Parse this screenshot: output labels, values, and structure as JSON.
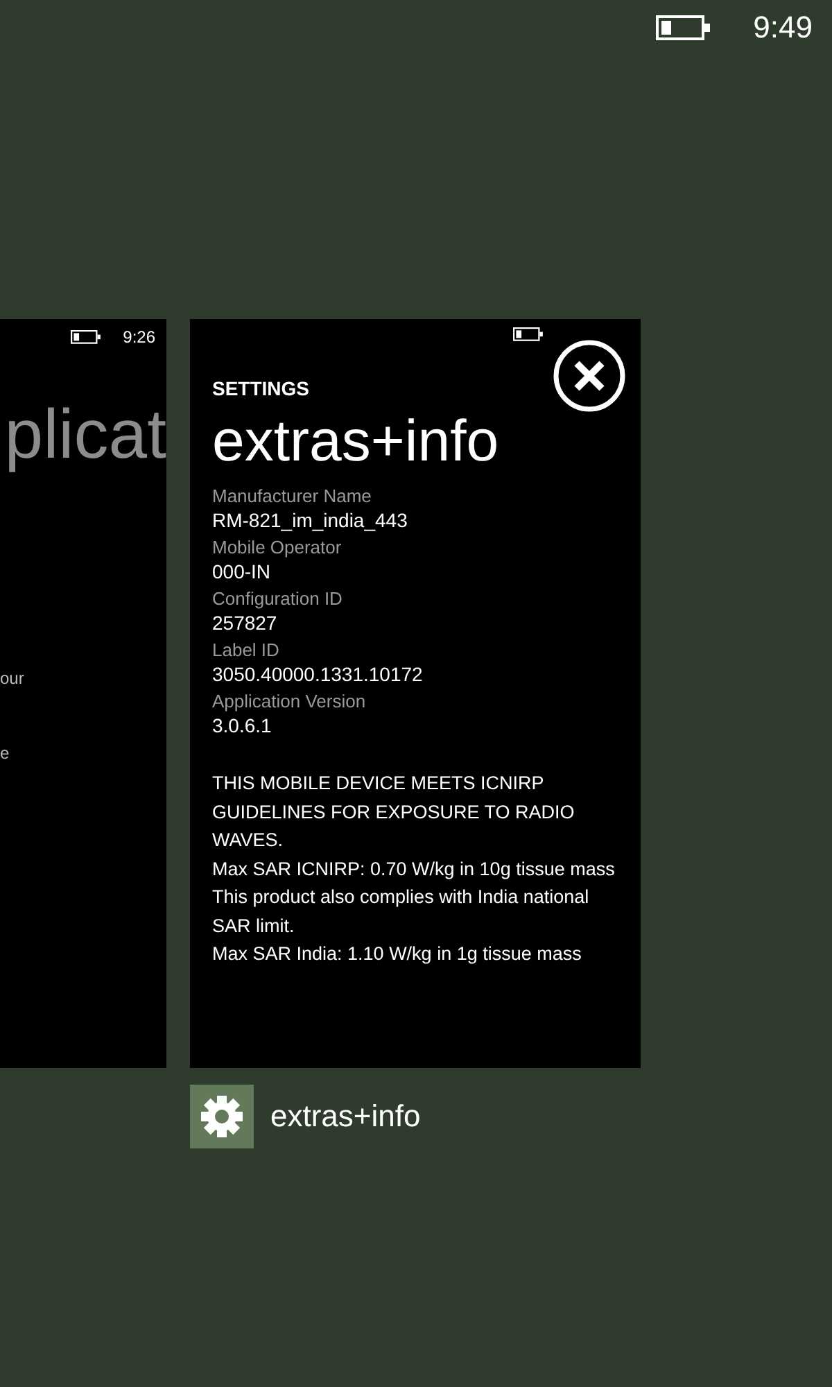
{
  "status_bar": {
    "time": "9:49"
  },
  "previous_app": {
    "time": "9:26",
    "title": "plicat",
    "fragments": [
      "our",
      "e"
    ]
  },
  "current_app": {
    "section": "SETTINGS",
    "title": "extras+info",
    "fields": [
      {
        "label": "Manufacturer Name",
        "value": "RM-821_im_india_443"
      },
      {
        "label": "Mobile Operator",
        "value": "000-IN"
      },
      {
        "label": "Configuration ID",
        "value": "257827"
      },
      {
        "label": "Label ID",
        "value": "3050.40000.1331.10172"
      },
      {
        "label": "Application Version",
        "value": "3.0.6.1"
      }
    ],
    "notice": [
      "THIS MOBILE DEVICE MEETS ICNIRP GUIDELINES FOR EXPOSURE TO RADIO WAVES.",
      "Max SAR ICNIRP: 0.70 W/kg in 10g tissue mass",
      "This product also complies with India national SAR limit.",
      "Max SAR India: 1.10 W/kg in 1g tissue mass"
    ]
  },
  "app_caption": {
    "label": "extras+info"
  }
}
